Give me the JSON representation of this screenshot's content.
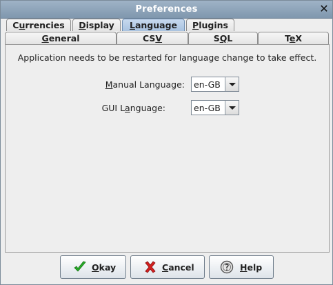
{
  "window": {
    "title": "Preferences",
    "close_glyph": "✕"
  },
  "tabs_row1": [
    {
      "pre": "C",
      "u": "u",
      "post": "rrencies",
      "selected": false
    },
    {
      "pre": "",
      "u": "D",
      "post": "isplay",
      "selected": false
    },
    {
      "pre": "",
      "u": "L",
      "post": "anguage",
      "selected": true
    },
    {
      "pre": "",
      "u": "P",
      "post": "lugins",
      "selected": false
    }
  ],
  "tabs_row2": [
    {
      "pre": "",
      "u": "G",
      "post": "eneral"
    },
    {
      "pre": "CS",
      "u": "V",
      "post": ""
    },
    {
      "pre": "S",
      "u": "Q",
      "post": "L"
    },
    {
      "pre": "T",
      "u": "e",
      "post": "X"
    }
  ],
  "panel": {
    "notice": "Application needs to be restarted for language change to take effect.",
    "manual_language": {
      "label_u": "M",
      "label_rest": "anual Language:",
      "value": "en-GB"
    },
    "gui_language": {
      "label_pre": "GUI L",
      "label_u": "a",
      "label_rest": "nguage:",
      "value": "en-GB"
    }
  },
  "buttons": {
    "okay": {
      "u": "O",
      "rest": "kay",
      "icon": "checkmark-icon"
    },
    "cancel": {
      "u": "C",
      "rest": "ancel",
      "icon": "cross-icon"
    },
    "help": {
      "u": "H",
      "rest": "elp",
      "icon": "help-icon"
    }
  },
  "colors": {
    "title_bar": "#8aa1b8",
    "selected_tab": "#b5cbe6",
    "check_green": "#28b028",
    "cross_red": "#d42020"
  }
}
